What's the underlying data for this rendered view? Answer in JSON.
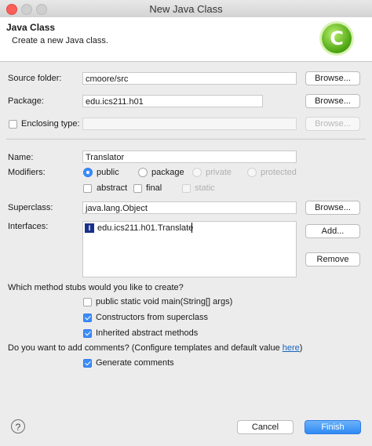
{
  "window": {
    "title": "New Java Class"
  },
  "header": {
    "title": "Java Class",
    "description": "Create a new Java class."
  },
  "source_folder": {
    "label": "Source folder:",
    "value": "cmoore/src",
    "browse": "Browse..."
  },
  "package": {
    "label": "Package:",
    "value": "edu.ics211.h01",
    "browse": "Browse..."
  },
  "enclosing": {
    "label": "Enclosing type:",
    "value": "",
    "browse": "Browse..."
  },
  "name": {
    "label": "Name:",
    "value": "Translator"
  },
  "modifiers": {
    "label": "Modifiers:",
    "public": "public",
    "package": "package",
    "private": "private",
    "protected": "protected",
    "abstract": "abstract",
    "final": "final",
    "static": "static"
  },
  "superclass": {
    "label": "Superclass:",
    "value": "java.lang.Object",
    "browse": "Browse..."
  },
  "interfaces": {
    "label": "Interfaces:",
    "items": [
      "edu.ics211.h01.Translate"
    ],
    "add": "Add...",
    "remove": "Remove",
    "icon_letter": "I"
  },
  "stubs": {
    "question": "Which method stubs would you like to create?",
    "main": "public static void main(String[] args)",
    "constructors": "Constructors from superclass",
    "inherited": "Inherited abstract methods"
  },
  "comments": {
    "question": "Do you want to add comments? (Configure templates and default value ",
    "link": "here",
    "end": ")",
    "generate": "Generate comments"
  },
  "footer": {
    "help": "?",
    "cancel": "Cancel",
    "finish": "Finish"
  },
  "colors": {
    "accent": "#3c8dfb",
    "close": "#fc5f57",
    "minimize": "#fdbc2e",
    "zoom": "#2bc840"
  }
}
